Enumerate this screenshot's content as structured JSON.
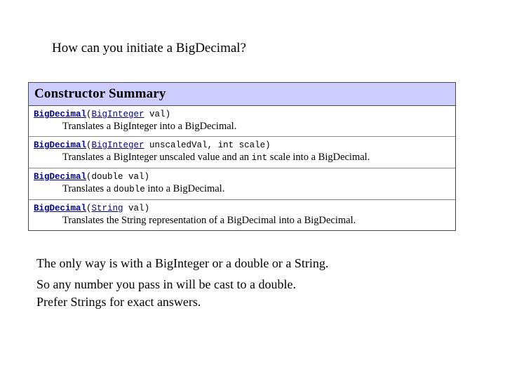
{
  "slide": {
    "title": "How can you initiate a BigDecimal?",
    "background_color": "#ffffff"
  },
  "javadoc_table": {
    "header": "Constructor Summary",
    "header_bg_color": "#ccccff",
    "border_color": "#4a4a4a",
    "link_color": "#00008f",
    "constructors": [
      {
        "name": "BigDecimal",
        "open_paren": "(",
        "params": [
          {
            "text": "BigInteger",
            "kind": "link"
          },
          {
            "text": " val",
            "kind": "plain"
          }
        ],
        "close_paren": ")",
        "description_parts": [
          {
            "text": "Translates a BigInteger into a BigDecimal.",
            "kind": "plain"
          }
        ]
      },
      {
        "name": "BigDecimal",
        "open_paren": "(",
        "params": [
          {
            "text": "BigInteger",
            "kind": "link"
          },
          {
            "text": " unscaledVal, int scale",
            "kind": "plain"
          }
        ],
        "close_paren": ")",
        "description_parts": [
          {
            "text": "Translates a BigInteger unscaled value and an ",
            "kind": "plain"
          },
          {
            "text": "int",
            "kind": "code"
          },
          {
            "text": " scale into a BigDecimal.",
            "kind": "plain"
          }
        ]
      },
      {
        "name": "BigDecimal",
        "open_paren": "(",
        "params": [
          {
            "text": "double val",
            "kind": "plain"
          }
        ],
        "close_paren": ")",
        "description_parts": [
          {
            "text": "Translates a ",
            "kind": "plain"
          },
          {
            "text": "double",
            "kind": "code"
          },
          {
            "text": " into a BigDecimal.",
            "kind": "plain"
          }
        ]
      },
      {
        "name": "BigDecimal",
        "open_paren": "(",
        "params": [
          {
            "text": "String",
            "kind": "link"
          },
          {
            "text": " val",
            "kind": "plain"
          }
        ],
        "close_paren": ")",
        "description_parts": [
          {
            "text": "Translates the String representation of a BigDecimal into a BigDecimal.",
            "kind": "plain"
          }
        ]
      }
    ]
  },
  "commentary": {
    "lines": [
      "The only way is with a BigInteger or a double or a String.",
      "So any number you pass in will be cast to a double.",
      "Prefer Strings for exact answers."
    ]
  }
}
